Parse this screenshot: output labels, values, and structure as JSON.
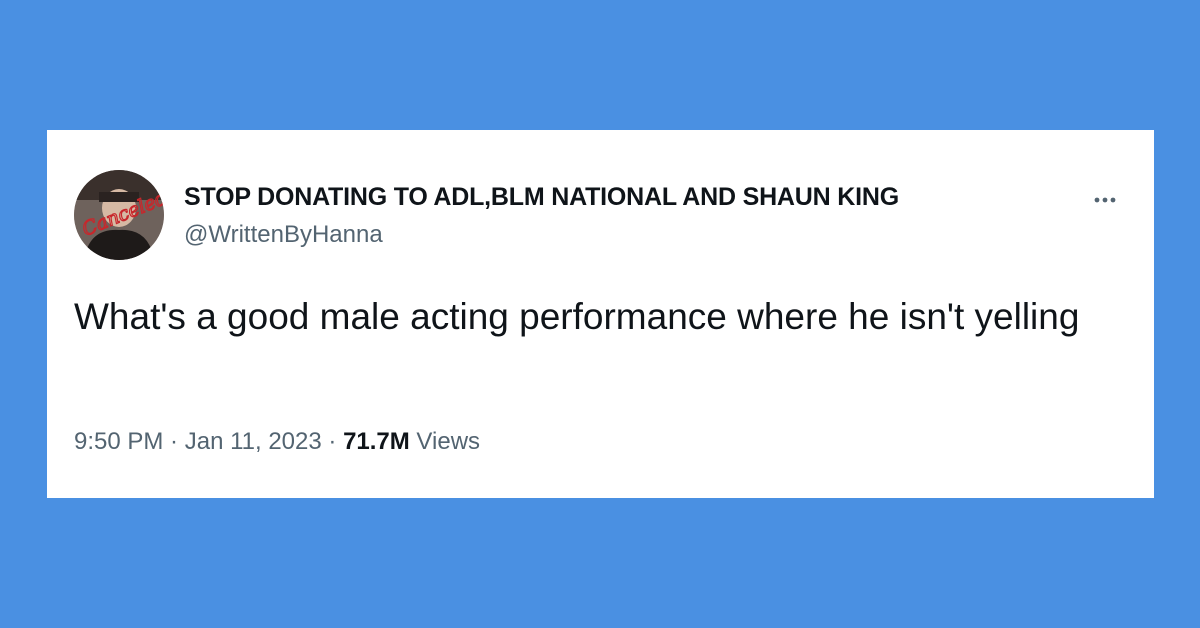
{
  "colors": {
    "background": "#4a90e2",
    "card": "#ffffff",
    "text_primary": "#0f1419",
    "text_secondary": "#536471",
    "avatar_stamp": "#c8262b"
  },
  "tweet": {
    "author": {
      "display_name": "STOP DONATING TO ADL,BLM NATIONAL AND SHAUN KING",
      "handle": "@WrittenByHanna",
      "avatar_stamp_text": "Canceled"
    },
    "more_icon": "more-horizontal-icon",
    "text": "What's a good male acting performance where he isn't yelling",
    "time": "9:50 PM",
    "separator": " · ",
    "date": "Jan 11, 2023",
    "views_count": "71.7M",
    "views_label": " Views"
  }
}
